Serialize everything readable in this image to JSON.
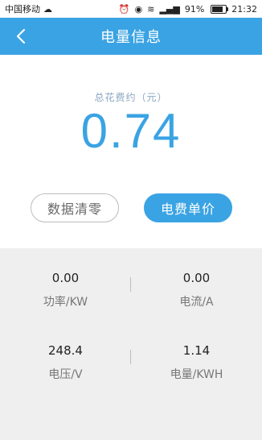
{
  "status_bar": {
    "carrier": "中国移动",
    "battery_percent": "91%",
    "time": "21:32",
    "icons": [
      "carrier-logo-icon",
      "alarm-icon",
      "eye-icon",
      "wifi-icon",
      "signal-icon",
      "battery-icon"
    ]
  },
  "header": {
    "title": "电量信息",
    "back_icon": "chevron-left-icon"
  },
  "summary": {
    "total_label": "总花费约（元）",
    "total_value": "0.74"
  },
  "actions": {
    "clear_label": "数据清零",
    "price_label": "电费单价"
  },
  "stats": [
    {
      "value": "0.00",
      "label": "功率/KW"
    },
    {
      "value": "0.00",
      "label": "电流/A"
    },
    {
      "value": "248.4",
      "label": "电压/V"
    },
    {
      "value": "1.14",
      "label": "电量/KWH"
    }
  ],
  "colors": {
    "accent": "#3aa3e3",
    "background": "#efefef"
  }
}
